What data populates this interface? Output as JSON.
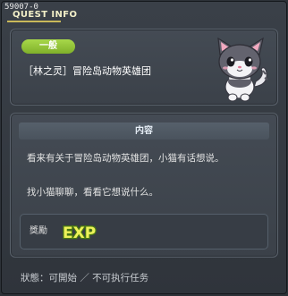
{
  "window": {
    "quest_id": "59007-0",
    "title": "QUEST INFO"
  },
  "quest": {
    "category": "一般",
    "name": "［林之灵］冒险岛动物英雄团"
  },
  "content": {
    "header": "内容",
    "lines": [
      "看来有关于冒险岛动物英雄团，小猫有话想说。",
      "找小猫聊聊，看看它想说什么。"
    ]
  },
  "reward": {
    "label": "獎勵",
    "exp_text": "EXP"
  },
  "status": {
    "text": "狀態：可開始 ／ 不可执行任务"
  },
  "colors": {
    "badge_green": "#8cc43a",
    "title_gold": "#c9b95a",
    "panel_bg": "#40464e"
  },
  "icons": {
    "portrait": "cat-npc-icon",
    "reward": "exp-icon"
  }
}
